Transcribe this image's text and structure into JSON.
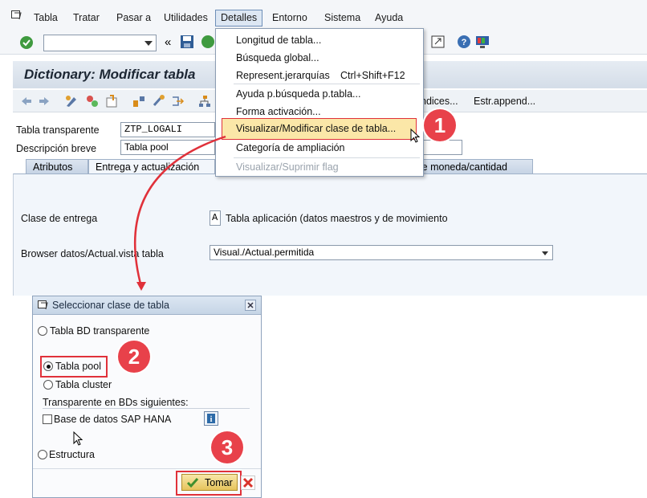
{
  "menubar": {
    "items": [
      {
        "label": "Tabla"
      },
      {
        "label": "Tratar"
      },
      {
        "label": "Pasar a"
      },
      {
        "label": "Utilidades"
      },
      {
        "label": "Detalles"
      },
      {
        "label": "Entorno"
      },
      {
        "label": "Sistema"
      },
      {
        "label": "Ayuda"
      }
    ]
  },
  "page": {
    "title": "Dictionary: Modificar tabla"
  },
  "apptoolbar": {
    "indices_label": "ndices...",
    "estr_append_label": "Estr.append..."
  },
  "fields": {
    "table_label": "Tabla transparente",
    "table_value": "ZTP_LOGALI",
    "desc_label": "Descripción breve",
    "desc_value": "Tabla pool"
  },
  "tabs": [
    {
      "label": "Atributos"
    },
    {
      "label": "Entrega y actualización"
    },
    {
      "label": "s de moneda/cantidad"
    }
  ],
  "delivery": {
    "class_label": "Clase de entrega",
    "class_code": "A",
    "class_text": "Tabla aplicación (datos maestros y de movimiento",
    "browser_label": "Browser datos/Actual.vista tabla",
    "browser_value": "Visual./Actual.permitida"
  },
  "detalles_menu": {
    "items": [
      {
        "label": "Longitud de tabla..."
      },
      {
        "label": "Búsqueda global..."
      },
      {
        "label": "Represent.jerarquías",
        "shortcut": "Ctrl+Shift+F12"
      },
      {
        "label": "Ayuda p.búsqueda p.tabla..."
      },
      {
        "label": "Forma activación..."
      },
      {
        "label": "Visualizar/Modificar clase de tabla..."
      },
      {
        "label": "Categoría de ampliación"
      },
      {
        "label": "Visualizar/Suprimir flag"
      }
    ]
  },
  "dialog": {
    "title": "Seleccionar clase de tabla",
    "radio_transparent": "Tabla BD transparente",
    "radio_pool": "Tabla pool",
    "radio_cluster": "Tabla cluster",
    "section_label": "Transparente en BDs siguientes:",
    "check_hana": "Base de datos SAP HANA",
    "radio_structure": "Estructura",
    "ok_label": "Tomar",
    "selected": "Tabla pool"
  },
  "callouts": [
    "1",
    "2",
    "3"
  ],
  "colors": {
    "highlight": "#e0313a",
    "menu_hover": "#fbe7a8",
    "title_bg": "#d4dde8"
  }
}
